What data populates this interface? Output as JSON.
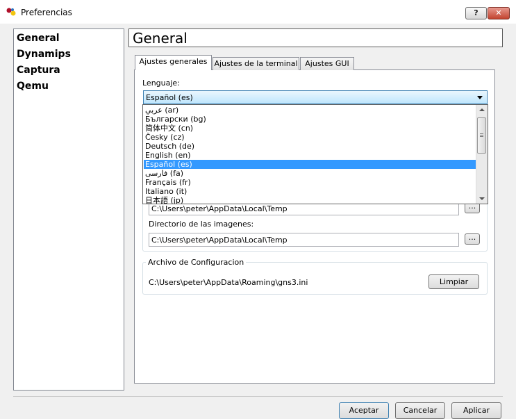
{
  "window": {
    "title": "Preferencias",
    "help_label": "?",
    "close_label": "✕"
  },
  "nav": {
    "items": [
      "General",
      "Dynamips",
      "Captura",
      "Qemu"
    ]
  },
  "header": {
    "title": "General"
  },
  "tabs": [
    "Ajustes generales",
    "Ajustes de la terminal",
    "Ajustes GUI"
  ],
  "language": {
    "label": "Lenguaje:",
    "selected": "Español (es)",
    "options": [
      "عربي (ar)",
      "Български (bg)",
      "简体中文 (cn)",
      "Česky (cz)",
      "Deutsch (de)",
      "English (en)",
      "Español (es)",
      "فارسی (fa)",
      "Français (fr)",
      "Italiano (it)",
      "日本語 (jp)"
    ]
  },
  "paths": {
    "projects_value": "C:\\Users\\peter\\AppData\\Local\\Temp",
    "images_label": "Directorio de las imagenes:",
    "images_value": "C:\\Users\\peter\\AppData\\Local\\Temp",
    "browse_label": "..."
  },
  "config": {
    "title": "Archivo de Configuracion",
    "path": "C:\\Users\\peter\\AppData\\Roaming\\gns3.ini",
    "clear_label": "Limpiar"
  },
  "buttons": {
    "accept": "Aceptar",
    "cancel": "Cancelar",
    "apply": "Aplicar"
  },
  "colors": {
    "selection": "#3399ff",
    "close": "#c2432f"
  }
}
